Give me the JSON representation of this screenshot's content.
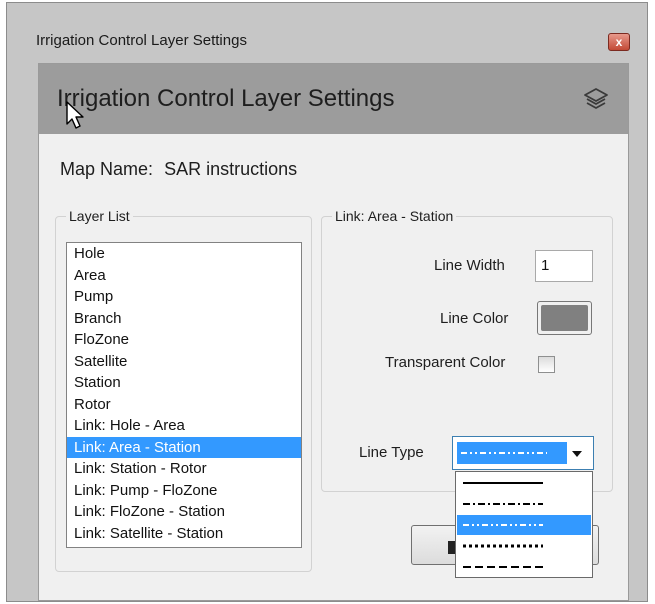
{
  "window": {
    "title": "Irrigation Control Layer Settings",
    "close_glyph": "x"
  },
  "header": {
    "title": "Irrigation Control Layer Settings",
    "icon": "layers-icon"
  },
  "map": {
    "label": "Map Name:",
    "value": "SAR instructions"
  },
  "layer_list": {
    "group_label": "Layer List",
    "selected": "Link: Area - Station",
    "items": [
      "Hole",
      "Area",
      "Pump",
      "Branch",
      "FloZone",
      "Satellite",
      "Station",
      "Rotor",
      "Link: Hole - Area",
      "Link: Area - Station",
      "Link: Station - Rotor",
      "Link: Pump - FloZone",
      "Link: FloZone - Station",
      "Link: Satellite - Station"
    ]
  },
  "settings": {
    "group_label": "Link: Area - Station",
    "line_width_label": "Line Width",
    "line_width_value": "1",
    "line_color_label": "Line Color",
    "line_color": "#808080",
    "transparent_label": "Transparent Color",
    "transparent_checked": false,
    "line_type_label": "Line Type",
    "line_type_selected": "dash-dot-dot",
    "line_type_options": [
      "solid",
      "dash-dot",
      "dash-dot-dot",
      "dot",
      "dash"
    ]
  },
  "colors": {
    "selection": "#3399ff",
    "header_bg": "#9c9c9c",
    "panel_bg": "#f0f0f0"
  }
}
